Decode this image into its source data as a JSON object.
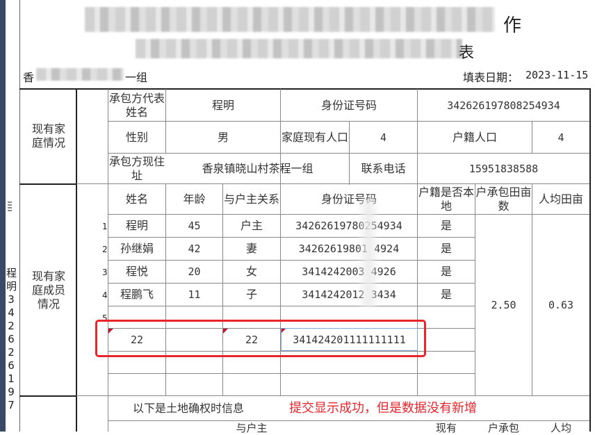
{
  "header": {
    "title_partial": "作",
    "subtitle_partial": "表",
    "village": "香泉镇晓山村茶程一组",
    "village_visible_prefix": "香",
    "village_visible_suffix": "一组",
    "date_label": "填表日期：",
    "date_value": "2023-11-15"
  },
  "left_vertical_text": [
    "程",
    "明",
    "3",
    "4",
    "2",
    "6",
    "2",
    "6",
    "1",
    "9",
    "7"
  ],
  "household": {
    "section_label": "现有家庭情况",
    "rep_name_label": "承包方代表姓名",
    "rep_name": "程明",
    "id_label": "身份证号码",
    "id_value": "342626197808254934",
    "gender_label": "性别",
    "gender": "男",
    "family_count_label": "家庭现有人口",
    "family_count": "4",
    "registered_count_label": "户籍人口",
    "registered_count": "4",
    "address_label": "承包方现住址",
    "address": "香泉镇晓山村茶程一组",
    "phone_label": "联系电话",
    "phone": "15951838588"
  },
  "members": {
    "section_label": "现有家庭成员情况",
    "columns": [
      "姓名",
      "年龄",
      "与户主关系",
      "身份证号码",
      "户籍是否本地",
      "户承包田亩数",
      "人均田亩"
    ],
    "rows": [
      {
        "num": "1",
        "name": "程明",
        "age": "45",
        "relation": "户主",
        "id": "34262619780254934",
        "local": "是"
      },
      {
        "num": "2",
        "name": "孙继娟",
        "age": "42",
        "relation": "妻",
        "id": "34262619801 4924",
        "local": "是"
      },
      {
        "num": "3",
        "name": "程悦",
        "age": "20",
        "relation": "女",
        "id": "3414242003  4926",
        "local": "是"
      },
      {
        "num": "4",
        "name": "程鹏飞",
        "age": "11",
        "relation": "子",
        "id": "3414242012  3434",
        "local": "是"
      },
      {
        "num": "5",
        "name": "",
        "age": "",
        "relation": "",
        "id": "",
        "local": ""
      }
    ],
    "new_row": {
      "name": "22",
      "age": "",
      "relation": "22",
      "id": "341424201111111111"
    },
    "mu_total": "2.50",
    "mu_per_person": "0.63"
  },
  "land": {
    "section_label": "以下是土地确权时信息",
    "annotation": "提交显示成功，但是数据没有新增",
    "partial_headers": [
      "与户主",
      "现有",
      "户承包",
      "人均"
    ]
  },
  "colors": {
    "annotation_red": "#e8252b",
    "cell_marker": "#c0152c",
    "sidebar": "#3a4a66"
  }
}
